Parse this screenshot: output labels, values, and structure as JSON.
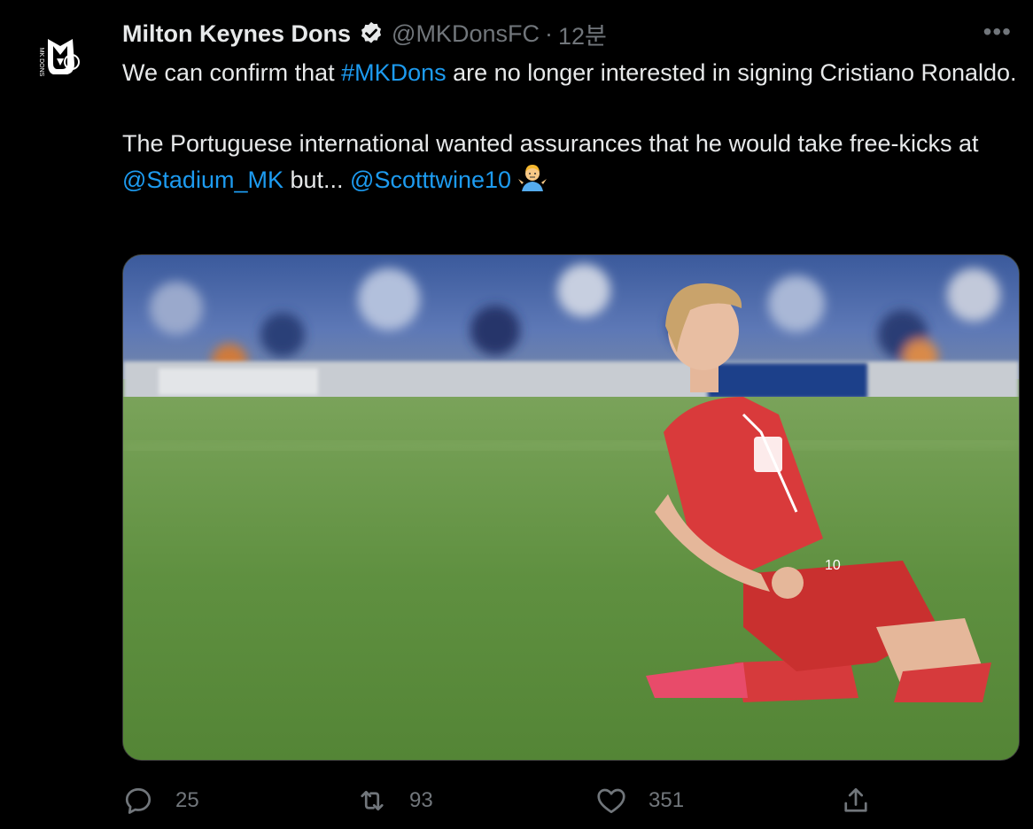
{
  "account": {
    "display_name": "Milton Keynes Dons",
    "verified": true,
    "handle": "@MKDonsFC",
    "separator": "·",
    "timestamp": "12분",
    "avatar_icon": "mk-dons-crest-icon",
    "avatar_lettering": "MK DONS"
  },
  "menu": {
    "icon": "more-horizontal-icon",
    "label": "•••"
  },
  "tweet": {
    "p1_before": "We can confirm that ",
    "p1_hashtag": "#MKDons",
    "p1_after": " are no longer interested in signing Cristiano Ronaldo.",
    "p2_before": "The Portuguese international wanted assurances that he would take free-kicks at ",
    "p2_mention1": "@Stadium_MK",
    "p2_middle": " but... ",
    "p2_mention2": "@Scotttwine10",
    "p2_emoji": "person-shrugging-emoji"
  },
  "media": {
    "description_icon": "football-player-knee-slide-photo",
    "shirt_number": "10"
  },
  "actions": {
    "reply_count": "25",
    "retweet_count": "93",
    "like_count": "351",
    "reply_icon": "reply-icon",
    "retweet_icon": "retweet-icon",
    "like_icon": "heart-icon",
    "share_icon": "share-icon"
  },
  "colors": {
    "background": "#000000",
    "text": "#e7e9ea",
    "secondary": "#71767b",
    "link": "#1d9bf0"
  }
}
